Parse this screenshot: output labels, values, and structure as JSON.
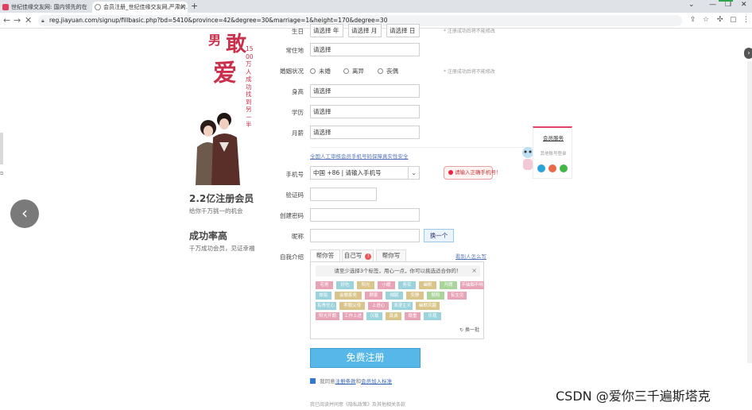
{
  "browser": {
    "tabs": [
      {
        "title": "世纪佳缘交友网: 国内领先的在..."
      },
      {
        "title": "会员注册_世纪佳缘交友网,严肃的..."
      }
    ],
    "new_tab": "+",
    "window_controls": [
      "⌄",
      "—",
      "❐",
      "✕"
    ],
    "url": "reg.jiayuan.com/signup/fillbasic.php?bd=5410&province=42&degree=30&marriage=1&height=170&degree=30"
  },
  "hero": {
    "title_small": "男",
    "title_c1": "敢",
    "title_c2": "爱",
    "vertical": "1500万人成功找到另一半"
  },
  "promo": [
    {
      "heading": "2.2亿注册会员",
      "sub": "给你千万挑一的机会"
    },
    {
      "heading": "成功率高",
      "sub": "千万成功会员，见证幸福"
    }
  ],
  "form": {
    "birthday": {
      "label": "生日",
      "year": "请选择 年",
      "month": "请选择 月",
      "day": "请选择 日",
      "hint": "* 注册成功后将不能修改"
    },
    "residence": {
      "label": "常住地",
      "value": "请选择"
    },
    "marriage": {
      "label": "婚姻状况",
      "options": [
        "未婚",
        "离异",
        "丧偶"
      ],
      "hint": "* 注册成功后将不能修改"
    },
    "height": {
      "label": "身高",
      "value": "请选择"
    },
    "education": {
      "label": "学历",
      "value": "请选择"
    },
    "income": {
      "label": "月薪",
      "value": "请选择"
    },
    "security_note": "全国人工审核会员手机号码保障真实性安全",
    "phone": {
      "label": "手机号",
      "value": "中国 +86 | 请输入手机号",
      "tip": "请输入正确手机号！"
    },
    "code": {
      "label": "验证码"
    },
    "password": {
      "label": "创建密码"
    },
    "nickname": {
      "label": "昵称",
      "button": "换一个"
    },
    "intro": {
      "label": "自我介绍",
      "tabs": [
        "帮你答",
        "自己写",
        "帮你写"
      ],
      "badge": "!",
      "tag_link": "看别人怎么写",
      "tag_tip": "请至少选择3个标签，用心一点，你可以挑选适合你的！",
      "tags": [
        "宅男",
        "好吃",
        "阳光",
        "小暖",
        "务实",
        "幽默",
        "开朗",
        "不抽烟不喝",
        "体贴",
        "会做家务",
        "顾家",
        "细腻",
        "安静",
        "随和",
        "有主见",
        "有责任心",
        "孝顺父母",
        "上进心",
        "浪漫主义",
        "幽默风趣",
        "阳光开朗",
        "工作上进",
        "沉稳",
        "真诚",
        "稳重",
        "乐观"
      ],
      "refresh": "换一批"
    },
    "submit": "免费注册",
    "agree_prefix": "我同意",
    "agree_link1": "注册条款",
    "agree_mid": "和",
    "agree_link2": "会员加入标准",
    "footer": "我已阅读并同意《隐私政策》及其他相关条款"
  },
  "service": {
    "title": "会员服务",
    "sub": "其他账号登录"
  },
  "nav": {
    "prev": "‹",
    "next": "›"
  },
  "watermark": "CSDN @爱你三千遍斯塔克",
  "colors": {
    "accent": "#57b7e8",
    "brand": "#c9304b"
  }
}
